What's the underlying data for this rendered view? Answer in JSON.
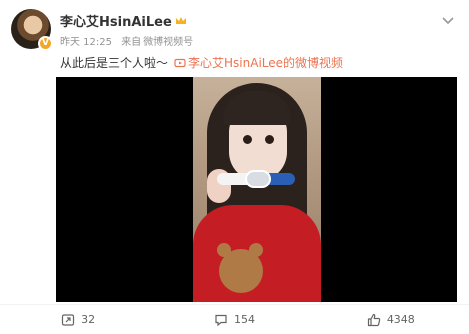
{
  "post": {
    "author": {
      "name": "李心艾HsinAiLee",
      "verified_badge": "V",
      "crown_icon": "crown-icon"
    },
    "meta": {
      "time": "昨天 12:25",
      "source_prefix": "来自",
      "source": "微博视频号"
    },
    "text": "从此后是三个人啦～",
    "link_text": "李心艾HsinAiLee的微博视频",
    "accent_color": "#eb7350"
  },
  "actions": {
    "repost_count": "32",
    "comment_count": "154",
    "like_count": "4348"
  }
}
